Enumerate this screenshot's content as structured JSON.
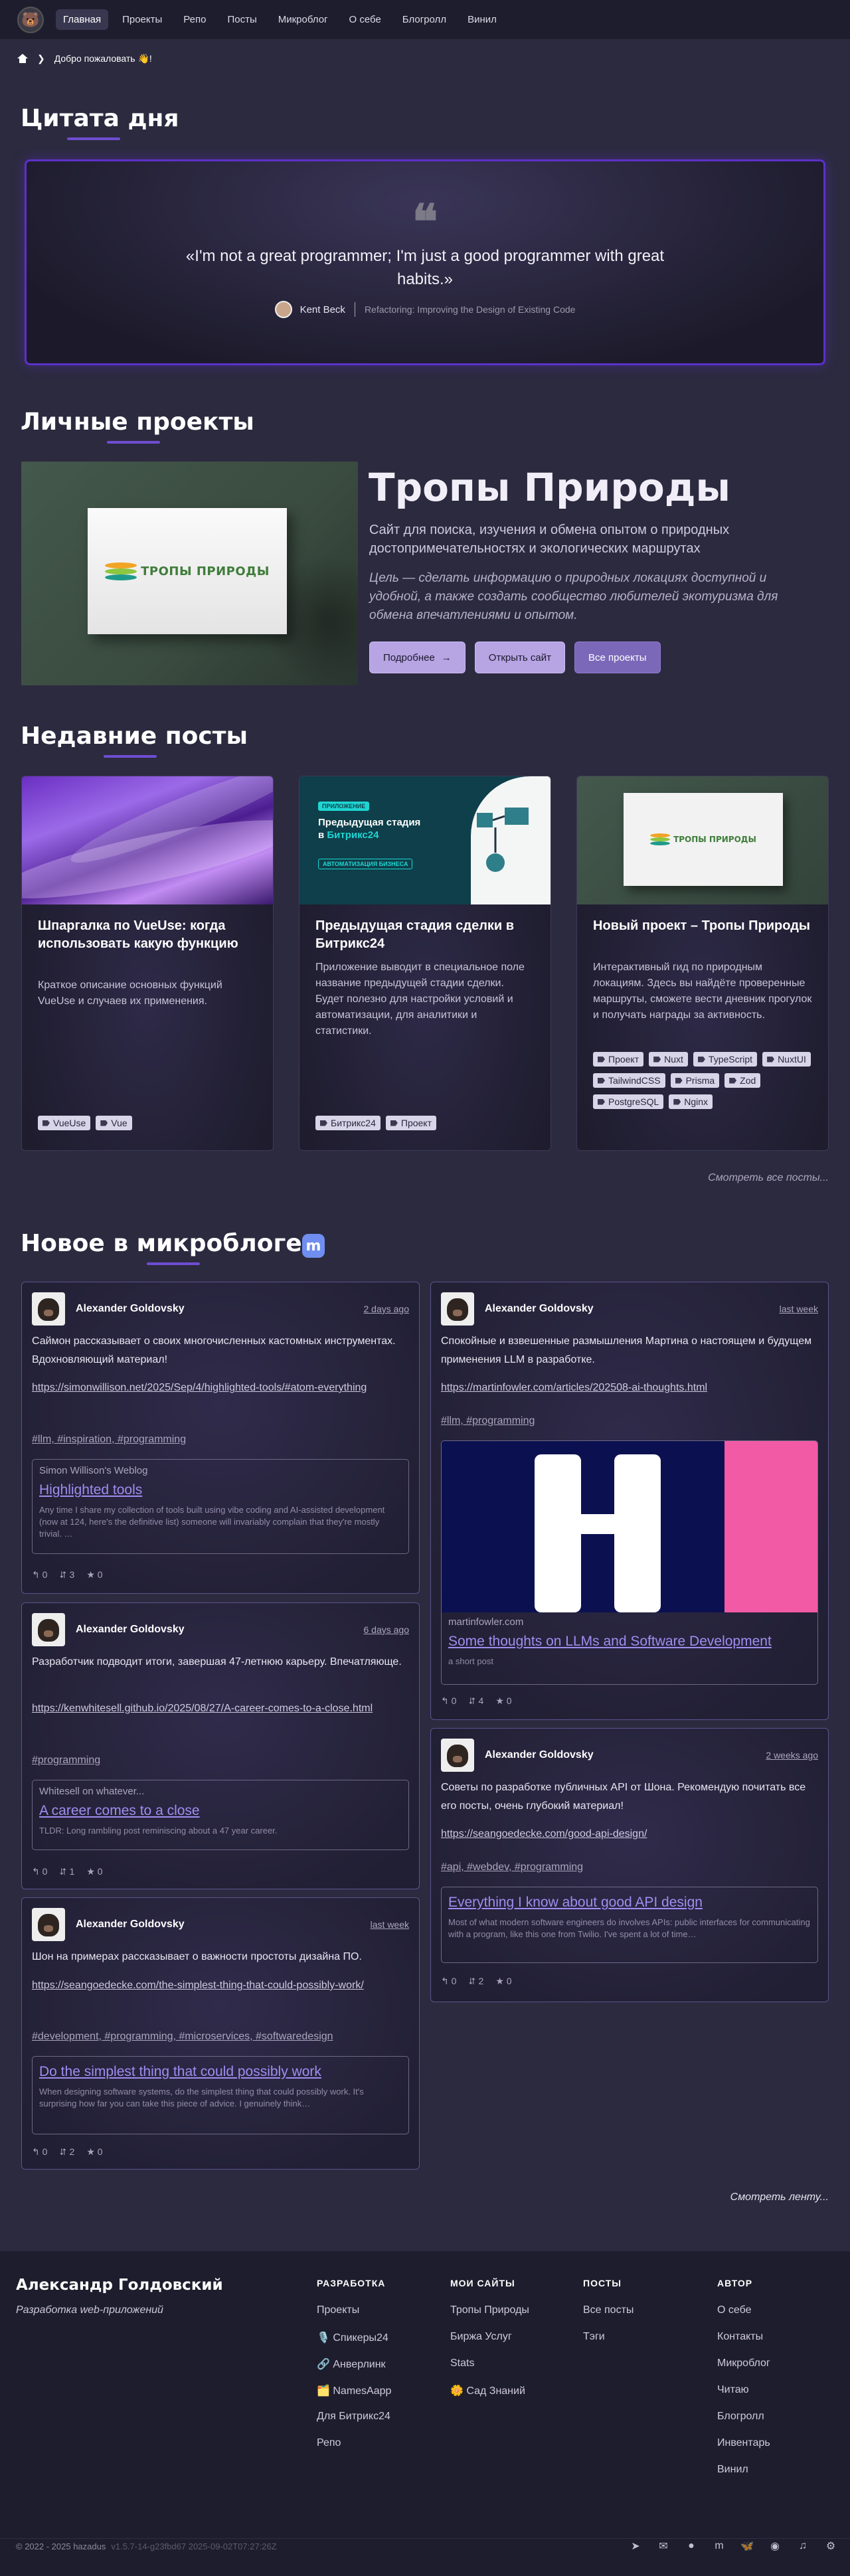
{
  "nav": {
    "items": [
      {
        "label": "Главная",
        "active": true
      },
      {
        "label": "Проекты"
      },
      {
        "label": "Репо"
      },
      {
        "label": "Посты"
      },
      {
        "label": "Микроблог"
      },
      {
        "label": "О себе"
      },
      {
        "label": "Блогролл"
      },
      {
        "label": "Винил"
      }
    ]
  },
  "breadcrumb": {
    "current": "Добро пожаловать 👋!"
  },
  "quote_section": {
    "title": "Цитата дня",
    "text": "«I'm not a great programmer; I'm just a good programmer with great habits.»",
    "author": "Kent Beck",
    "source": "Refactoring: Improving the Design of Existing Code"
  },
  "projects_section": {
    "title": "Личные проекты",
    "project": {
      "name": "Тропы Природы",
      "sign_text": "ТРОПЫ ПРИРОДЫ",
      "description": "Сайт для поиска, изучения и обмена опытом о природных достопримечательностях и экологических маршрутах",
      "goal": "Цель — сделать информацию о природных локациях доступной и удобной, а также создать сообщество любителей экотуризма для обмена впечатлениями и опытом.",
      "buttons": {
        "details": "Подробнее",
        "open_site": "Открыть сайт",
        "all_projects": "Все проекты"
      }
    }
  },
  "posts_section": {
    "title": "Недавние посты",
    "more": "Смотреть все посты...",
    "posts": [
      {
        "title": "Шпаргалка по VueUse: когда использовать какую функцию",
        "excerpt": "Краткое описание основных функций VueUse и случаев их применения.",
        "tags": [
          "VueUse",
          "Vue"
        ]
      },
      {
        "title": "Предыдущая стадия сделки в Битрикс24",
        "excerpt": "Приложение выводит в специальное поле название предыдущей стадии сделки. Будет полезно для настройки условий и автоматизации, для аналитики и статистики.",
        "tags": [
          "Битрикс24",
          "Проект"
        ],
        "image_badge": "ПРИЛОЖЕНИЕ",
        "image_title_1": "Предыдущая стадия",
        "image_title_2": "в ",
        "image_title_brand": "Битрикс24",
        "image_chip": "АВТОМАТИЗАЦИЯ БИЗНЕСА"
      },
      {
        "title": "Новый проект – Тропы Природы",
        "excerpt": "Интерактивный гид по природным локациям. Здесь вы найдёте проверенные маршруты, сможете вести дневник прогулок и получать награды за активность.",
        "tags": [
          "Проект",
          "Nuxt",
          "TypeScript",
          "NuxtUI",
          "TailwindCSS",
          "Prisma",
          "Zod",
          "PostgreSQL",
          "Nginx"
        ],
        "image_sign": "ТРОПЫ ПРИРОДЫ"
      }
    ]
  },
  "microblog_section": {
    "title": "Новое в микроблоге",
    "more": "Смотреть ленту...",
    "toots": [
      {
        "author": "Alexander Goldovsky",
        "date": "2 days ago",
        "text": "Саймон рассказывает о своих многочисленных кастомных инструментах. Вдохновляющий материал!",
        "link": "https://simonwillison.net/2025/Sep/4/highlighted-tools/#atom-everything",
        "tags": "#llm, #inspiration, #programming",
        "preview": {
          "site": "Simon Willison's Weblog",
          "title": "Highlighted tools",
          "desc": "Any time I share my collection of tools built using vibe coding and AI-assisted development (now at 124, here's the definitive list) someone will invariably complain that they're mostly trivial. …"
        },
        "replies": "0",
        "boosts": "3",
        "favs": "0"
      },
      {
        "author": "Alexander Goldovsky",
        "date": "6 days ago",
        "text": "Разработчик подводит итоги, завершая 47-летнюю карьеру. Впечатляюще.",
        "link": "https://kenwhitesell.github.io/2025/08/27/A-career-comes-to-a-close.html",
        "tags": "#programming",
        "preview": {
          "site": "Whitesell on whatever...",
          "title": "A career comes to a close",
          "desc": "TLDR: Long rambling post reminiscing about a 47 year career."
        },
        "replies": "0",
        "boosts": "1",
        "favs": "0"
      },
      {
        "author": "Alexander Goldovsky",
        "date": "last week",
        "text": "Шон на примерах рассказывает о важности простоты дизайна ПО.",
        "link": "https://seangoedecke.com/the-simplest-thing-that-could-possibly-work/",
        "tags": "#development, #programming, #microservices, #softwaredesign",
        "preview": {
          "site": "",
          "title": "Do the simplest thing that could possibly work",
          "desc": "When designing software systems, do the simplest thing that could possibly work. It's surprising how far you can take this piece of advice. I genuinely think…"
        },
        "replies": "0",
        "boosts": "2",
        "favs": "0"
      },
      {
        "author": "Alexander Goldovsky",
        "date": "last week",
        "text": "Спокойные и взвешенные размышления Мартина о настоящем и будущем применения LLM в разработке.",
        "link": "https://martinfowler.com/articles/202508-ai-thoughts.html",
        "tags": "#llm, #programming",
        "preview": {
          "site": "martinfowler.com",
          "title": "Some thoughts on LLMs and Software Development",
          "desc": "a short post"
        },
        "replies": "0",
        "boosts": "4",
        "favs": "0"
      },
      {
        "author": "Alexander Goldovsky",
        "date": "2 weeks ago",
        "text": "Советы по разработке публичных API от Шона. Рекомендую почитать все его посты, очень глубокий материал!",
        "link": "https://seangoedecke.com/good-api-design/",
        "tags": "#api, #webdev, #programming",
        "preview": {
          "site": "",
          "title": "Everything I know about good API design",
          "desc": "Most of what modern software engineers do involves APIs: public interfaces for communicating with a program, like this one from Twilio. I've spent a lot of time…"
        },
        "replies": "0",
        "boosts": "2",
        "favs": "0"
      }
    ]
  },
  "footer": {
    "name": "Александр Голдовский",
    "tagline": "Разработка web-приложений",
    "columns": [
      {
        "title": "РАЗРАБОТКА",
        "links": [
          "Проекты",
          "🎙️ Спикеры24",
          "🔗 Анверлинк",
          "🗂️ NamesAapp",
          "Для Битрикс24",
          "Репо"
        ]
      },
      {
        "title": "МОИ САЙТЫ",
        "links": [
          "Тропы Природы",
          "Биржа Услуг",
          "Stats",
          "🌼 Сад Знаний"
        ]
      },
      {
        "title": "ПОСТЫ",
        "links": [
          "Все посты",
          "Тэги"
        ]
      },
      {
        "title": "АВТОР",
        "links": [
          "О себе",
          "Контакты",
          "Микроблог",
          "Читаю",
          "Блогролл",
          "Инвентарь",
          "Винил"
        ]
      }
    ],
    "copyright": "© 2022 - 2025 hazadus",
    "version": "v1.5.7-14-g23fbd67 2025-09-02T07:27:26Z",
    "social_icons": [
      "telegram-icon",
      "email-icon",
      "github-icon",
      "mastodon-icon",
      "bluesky-icon",
      "rss-icon",
      "lastfm-icon",
      "steam-icon"
    ]
  },
  "colors": {
    "accent": "#5b31c8",
    "background": "#2c2a3f",
    "header": "#1e1d2d",
    "tag": "#d9d5e8",
    "link": "#a08df0"
  }
}
